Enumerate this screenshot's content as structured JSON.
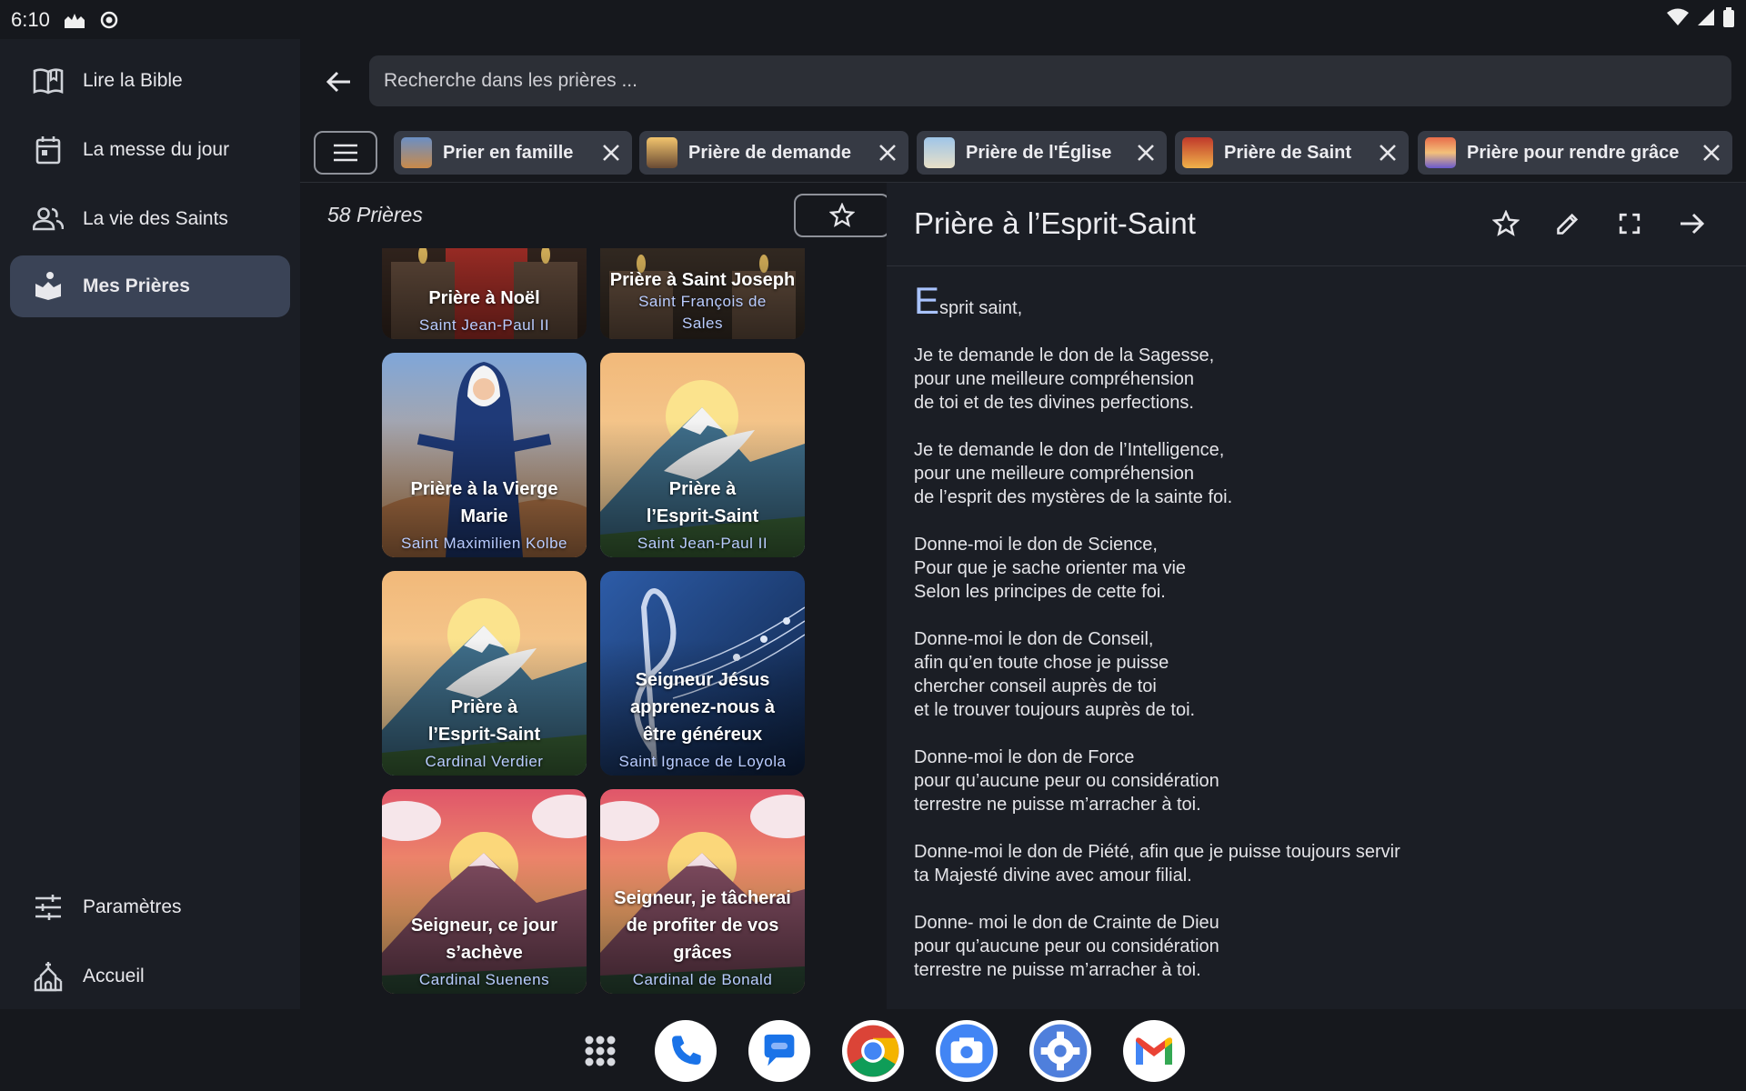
{
  "status_bar": {
    "time": "6:10"
  },
  "drawer": {
    "items": [
      {
        "label": "Lire la Bible",
        "icon": "book-open-icon"
      },
      {
        "label": "La messe du jour",
        "icon": "calendar-icon"
      },
      {
        "label": "La vie des Saints",
        "icon": "people-icon"
      },
      {
        "label": "Mes Prières",
        "icon": "praying-hands-icon",
        "active": true
      }
    ],
    "bottom_items": [
      {
        "label": "Paramètres",
        "icon": "sliders-icon"
      },
      {
        "label": "Accueil",
        "icon": "church-icon"
      }
    ]
  },
  "search": {
    "placeholder": "Recherche dans les prières ..."
  },
  "filters": [
    {
      "label": "Prier en famille"
    },
    {
      "label": "Prière de demande"
    },
    {
      "label": "Prière de l'Église"
    },
    {
      "label": "Prière de Saint"
    },
    {
      "label": "Prière pour rendre grâce"
    }
  ],
  "list": {
    "count_label": "58 Prières",
    "cards": [
      {
        "title": "Prière à Noël",
        "author": "Saint Jean-Paul II",
        "art": "candles"
      },
      {
        "title": "Prière à Saint Joseph",
        "author": "Saint François de Sales",
        "art": "candles"
      },
      {
        "title": "Prière à la Vierge Marie",
        "author": "Saint Maximilien Kolbe",
        "art": "mary"
      },
      {
        "title": "Prière à l’Esprit-Saint",
        "author": "Saint Jean-Paul II",
        "art": "dove"
      },
      {
        "title": "Prière à l’Esprit-Saint",
        "author": "Cardinal Verdier",
        "art": "dove"
      },
      {
        "title": "Seigneur Jésus apprenez-nous à être généreux",
        "author": "Saint Ignace de Loyola",
        "art": "music"
      },
      {
        "title": "Seigneur, ce jour s’achève",
        "author": "Cardinal Suenens",
        "art": "sunset"
      },
      {
        "title": "Seigneur, je tâcherai de profiter de vos grâces",
        "author": "Cardinal de Bonald",
        "art": "sunset"
      }
    ]
  },
  "detail": {
    "title": "Prière à l’Esprit-Saint",
    "lead_letter": "E",
    "lead_rest": "sprit saint,",
    "paragraphs": [
      "Je te demande le don de la Sagesse,\npour une meilleure compréhension\nde toi et de tes divines perfections.",
      "Je te demande le don de l’Intelligence,\npour une meilleure compréhension\nde l’esprit des mystères de la sainte foi.",
      "Donne-moi le don de Science,\nPour que je sache orienter ma vie\nSelon les principes de cette foi.",
      "Donne-moi le don de Conseil,\nafin qu’en toute chose je puisse\nchercher conseil auprès de toi\net le trouver toujours auprès de toi.",
      "Donne-moi le don de Force\npour qu’aucune peur ou considération\nterrestre ne puisse m’arracher à toi.",
      "Donne-moi le don de Piété, afin que je puisse toujours servir\nta Majesté divine avec amour filial.",
      "Donne- moi le don de Crainte de Dieu\npour qu’aucune peur ou considération\nterrestre ne puisse m’arracher à toi."
    ]
  },
  "dock": {
    "apps": [
      "apps-grid-icon",
      "phone-icon",
      "messages-icon",
      "chrome-icon",
      "camera-icon",
      "settings-icon",
      "gmail-icon"
    ]
  },
  "colors": {
    "accent": "#a9c3ff",
    "active_nav": "#3a4356",
    "author_text": "#b9ccff"
  }
}
